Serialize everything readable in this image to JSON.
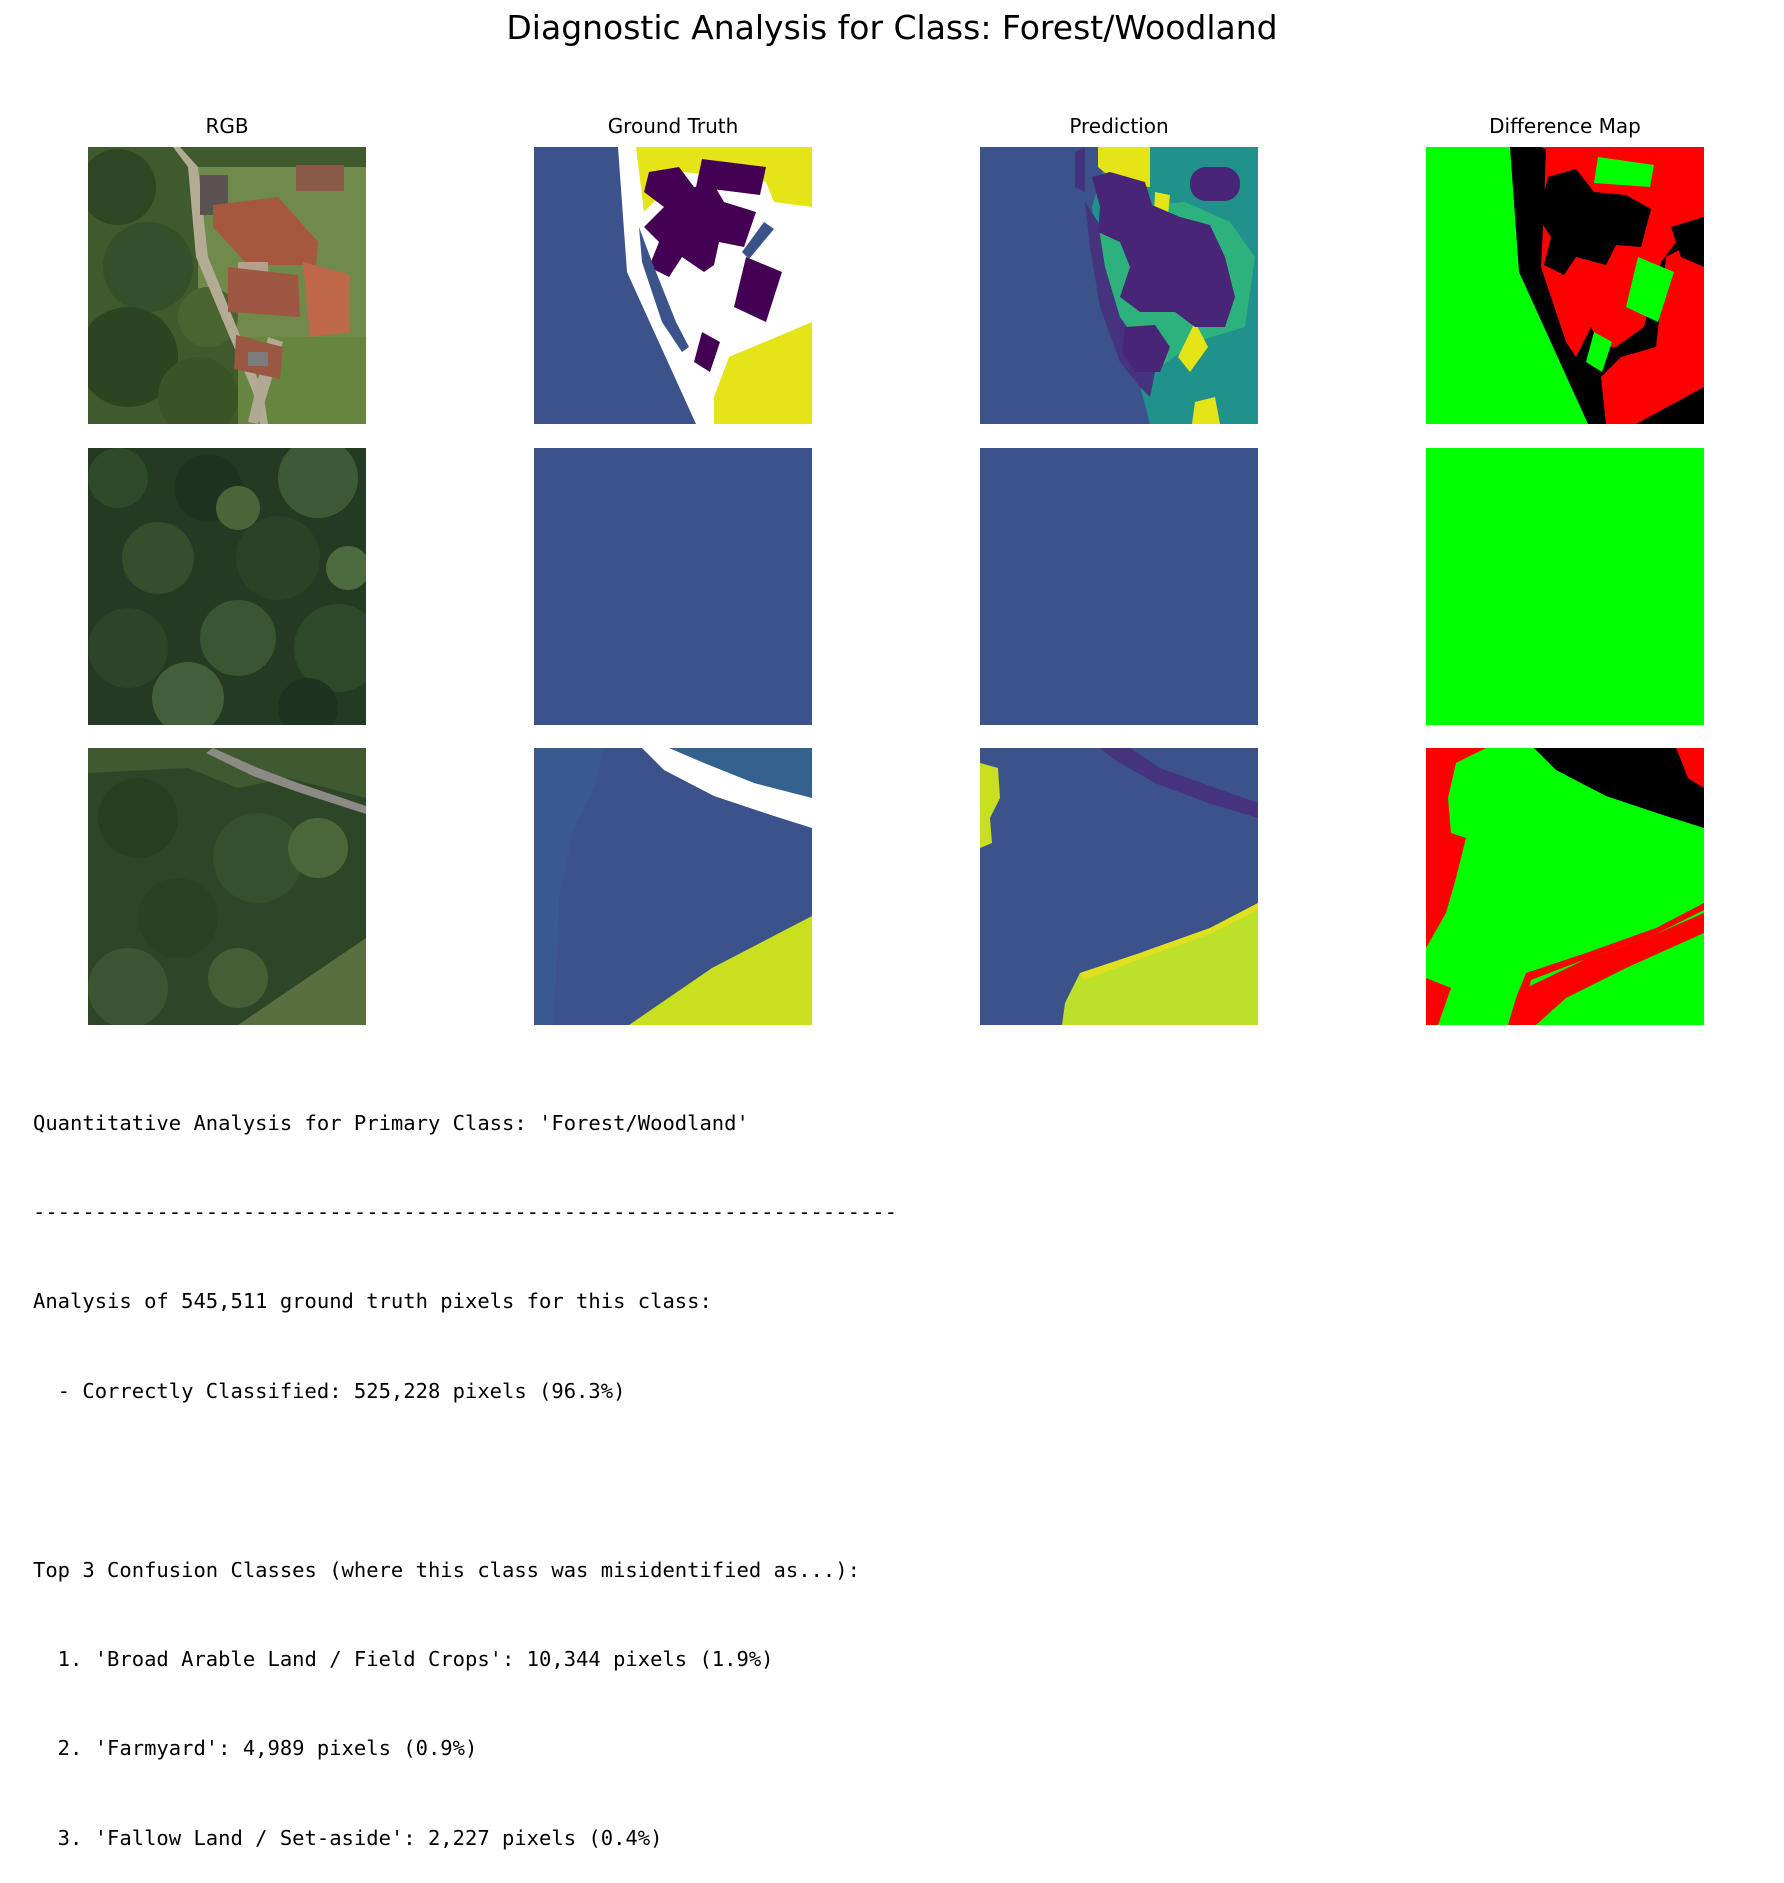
{
  "figure": {
    "title": "Diagnostic Analysis for Class: Forest/Woodland",
    "columns": [
      "RGB",
      "Ground Truth",
      "Prediction",
      "Difference Map"
    ]
  },
  "colors": {
    "forest_class": "#3b528b",
    "building_class": "#440154",
    "other_class_teal": "#21918c",
    "other_class_green": "#2db27d",
    "other_class_yellow": "#e5e419",
    "ignore": "#ffffff",
    "correct": "#00ff00",
    "incorrect": "#ff0000",
    "masked": "#000000"
  },
  "report": {
    "heading": "Quantitative Analysis for Primary Class: 'Forest/Woodland'",
    "divider": "----------------------------------------------------------------------",
    "summary": "Analysis of 545,511 ground truth pixels for this class:",
    "correct": "  - Correctly Classified: 525,228 pixels (96.3%)",
    "confusion_heading": "Top 3 Confusion Classes (where this class was misidentified as...):",
    "confusions": [
      "  1. 'Broad Arable Land / Field Crops': 10,344 pixels (1.9%)",
      "  2. 'Farmyard': 4,989 pixels (0.9%)",
      "  3. 'Fallow Land / Set-aside': 2,227 pixels (0.4%)"
    ]
  }
}
